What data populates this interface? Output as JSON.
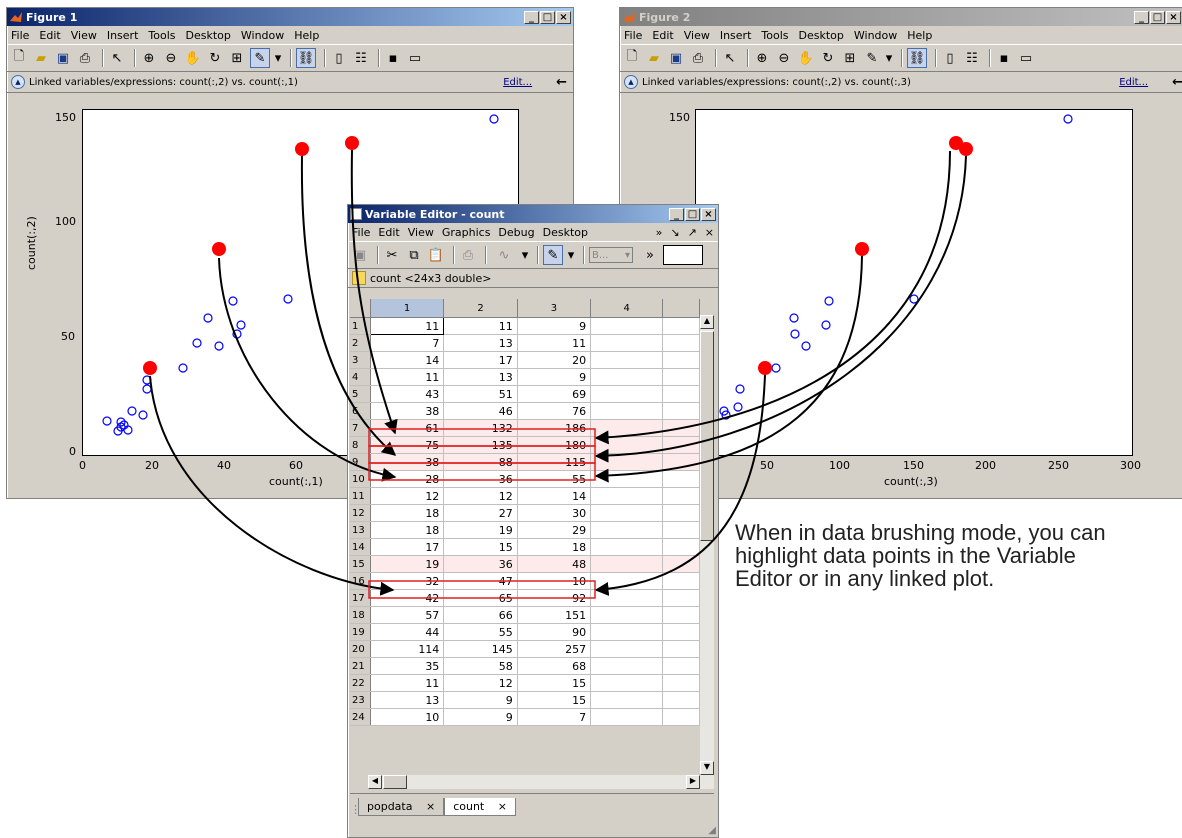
{
  "figure1": {
    "title": "Figure 1",
    "menus": [
      "File",
      "Edit",
      "View",
      "Insert",
      "Tools",
      "Desktop",
      "Window",
      "Help"
    ],
    "link_text": "Linked variables/expressions: count(:,2) vs. count(:,1)",
    "edit_label": "Edit...",
    "xlabel": "count(:,1)",
    "ylabel": "count(:,2)",
    "xticks": [
      "0",
      "20",
      "40",
      "60"
    ],
    "yticks": [
      "0",
      "50",
      "100",
      "150"
    ]
  },
  "figure2": {
    "title": "Figure 2",
    "menus": [
      "File",
      "Edit",
      "View",
      "Insert",
      "Tools",
      "Desktop",
      "Window",
      "Help"
    ],
    "link_text": "Linked variables/expressions: count(:,2) vs. count(:,3)",
    "edit_label": "Edit...",
    "xlabel": "count(:,3)",
    "ylabel": "count(:,2)",
    "xticks": [
      "50",
      "100",
      "150",
      "200",
      "250",
      "300"
    ],
    "yticks": [
      "150"
    ]
  },
  "variable_editor": {
    "title": "Variable Editor - count",
    "menus": [
      "File",
      "Edit",
      "View",
      "Graphics",
      "Debug",
      "Desktop"
    ],
    "var_label": "count <24x3 double>",
    "col_headers": [
      "1",
      "2",
      "3",
      "4"
    ],
    "rows": [
      [
        "11",
        "11",
        "9"
      ],
      [
        "7",
        "13",
        "11"
      ],
      [
        "14",
        "17",
        "20"
      ],
      [
        "11",
        "13",
        "9"
      ],
      [
        "43",
        "51",
        "69"
      ],
      [
        "38",
        "46",
        "76"
      ],
      [
        "61",
        "132",
        "186"
      ],
      [
        "75",
        "135",
        "180"
      ],
      [
        "38",
        "88",
        "115"
      ],
      [
        "28",
        "36",
        "55"
      ],
      [
        "12",
        "12",
        "14"
      ],
      [
        "18",
        "27",
        "30"
      ],
      [
        "18",
        "19",
        "29"
      ],
      [
        "17",
        "15",
        "18"
      ],
      [
        "19",
        "36",
        "48"
      ],
      [
        "32",
        "47",
        "10"
      ],
      [
        "42",
        "65",
        "92"
      ],
      [
        "57",
        "66",
        "151"
      ],
      [
        "44",
        "55",
        "90"
      ],
      [
        "114",
        "145",
        "257"
      ],
      [
        "35",
        "58",
        "68"
      ],
      [
        "11",
        "12",
        "15"
      ],
      [
        "13",
        "9",
        "15"
      ],
      [
        "10",
        "9",
        "7"
      ]
    ],
    "highlighted_rows": [
      7,
      8,
      9,
      15
    ],
    "tabs": [
      "popdata",
      "count"
    ],
    "toolbar_box_label": "B..."
  },
  "caption": "When in data brushing mode, you can highlight data points in the Variable Editor or in any linked plot.",
  "colors": {
    "brush": "#ff0000",
    "marker": "#0000ff",
    "title_active": "#0a246a"
  }
}
